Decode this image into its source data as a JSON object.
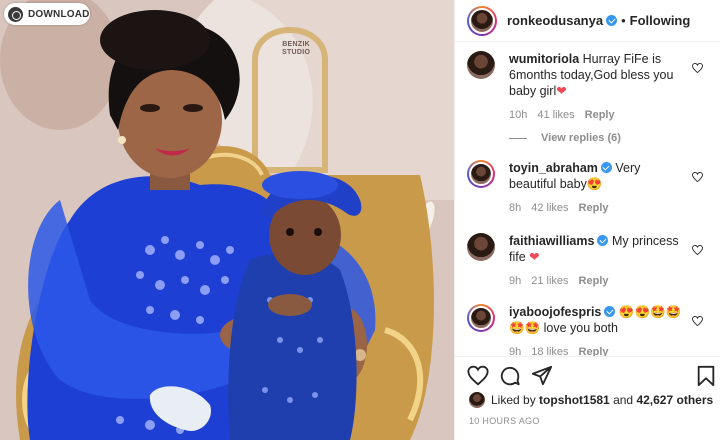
{
  "photo": {
    "download_label": "DOWNLOAD",
    "watermark_line1": "BENZIK",
    "watermark_line2": "STUDIO"
  },
  "header": {
    "username": "ronkeodusanya",
    "separator": "•",
    "follow_status": "Following"
  },
  "comments": [
    {
      "username": "wumitoriola",
      "text": "Hurray FiFe is 6months today,God bless you baby girl",
      "emoji": "❤",
      "age": "10h",
      "likes": "41 likes",
      "reply": "Reply"
    },
    {
      "username": "toyin_abraham",
      "text": "Very beautiful baby",
      "emoji": "😍",
      "age": "8h",
      "likes": "42 likes",
      "reply": "Reply"
    },
    {
      "username": "faithiawilliams",
      "text": "My princess fife",
      "emoji": "❤",
      "age": "9h",
      "likes": "21 likes",
      "reply": "Reply"
    },
    {
      "username": "iyaboojofespris",
      "text": "love you both",
      "emoji": "😍😍🤩🤩🤩🤩",
      "age": "9h",
      "likes": "18 likes",
      "reply": "Reply"
    }
  ],
  "view_replies": "View replies (6)",
  "likes_summary": {
    "prefix": "Liked by",
    "user": "topshot1581",
    "middle": "and",
    "others": "42,627 others"
  },
  "timestamp": "10 HOURS AGO",
  "icons": [
    "download-icon",
    "heart-icon",
    "comment-icon",
    "share-icon",
    "bookmark-icon",
    "verified-badge-icon"
  ],
  "colors": {
    "verified": "#3897f0",
    "heart": "#ed4956",
    "meta": "#8e8e8e",
    "dress_blue": "#1a3fd6"
  }
}
